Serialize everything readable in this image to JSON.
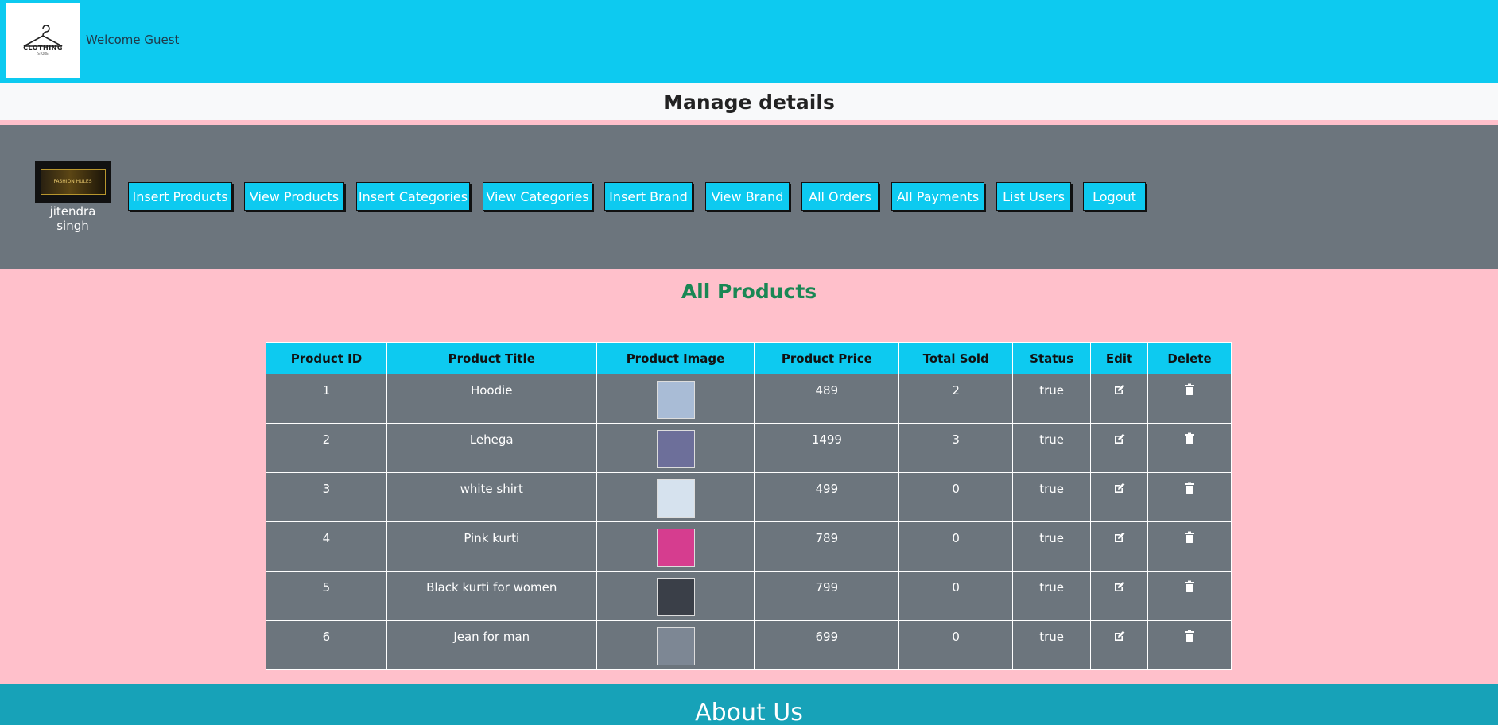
{
  "header": {
    "logo_text": "CLOTHING",
    "logo_sub": "STORE",
    "welcome": "Welcome Guest"
  },
  "manage_title": "Manage details",
  "admin": {
    "name": "jitendra singh",
    "pic_text": "FASHION HULES"
  },
  "nav": [
    {
      "label": "Insert Products"
    },
    {
      "label": "View Products"
    },
    {
      "label": "Insert Categories"
    },
    {
      "label": "View Categories"
    },
    {
      "label": "Insert Brand"
    },
    {
      "label": "View Brand"
    },
    {
      "label": "All Orders"
    },
    {
      "label": "All Payments"
    },
    {
      "label": "List Users"
    },
    {
      "label": "Logout"
    }
  ],
  "products": {
    "title": "All Products",
    "columns": [
      "Product ID",
      "Product Title",
      "Product Image",
      "Product Price",
      "Total Sold",
      "Status",
      "Edit",
      "Delete"
    ],
    "rows": [
      {
        "id": "1",
        "title": "Hoodie",
        "image_color": "#a9bcd6",
        "price": "489",
        "sold": "2",
        "status": "true"
      },
      {
        "id": "2",
        "title": "Lehega",
        "image_color": "#6d6f9a",
        "price": "1499",
        "sold": "3",
        "status": "true"
      },
      {
        "id": "3",
        "title": "white shirt",
        "image_color": "#d6e2ee",
        "price": "499",
        "sold": "0",
        "status": "true"
      },
      {
        "id": "4",
        "title": "Pink kurti",
        "image_color": "#d63d8f",
        "price": "789",
        "sold": "0",
        "status": "true"
      },
      {
        "id": "5",
        "title": "Black kurti for women",
        "image_color": "#3a3f48",
        "price": "799",
        "sold": "0",
        "status": "true"
      },
      {
        "id": "6",
        "title": "Jean for man",
        "image_color": "#7d8794",
        "price": "699",
        "sold": "0",
        "status": "true"
      }
    ],
    "edit_icon": "edit-icon",
    "delete_icon": "trash-icon"
  },
  "footer": {
    "title": "About Us"
  },
  "colors": {
    "accent": "#0dcaf0",
    "admin_bar": "#6c757d",
    "page_bg": "#ffc0cb",
    "title_green": "#198754",
    "footer": "#17a2b8"
  }
}
